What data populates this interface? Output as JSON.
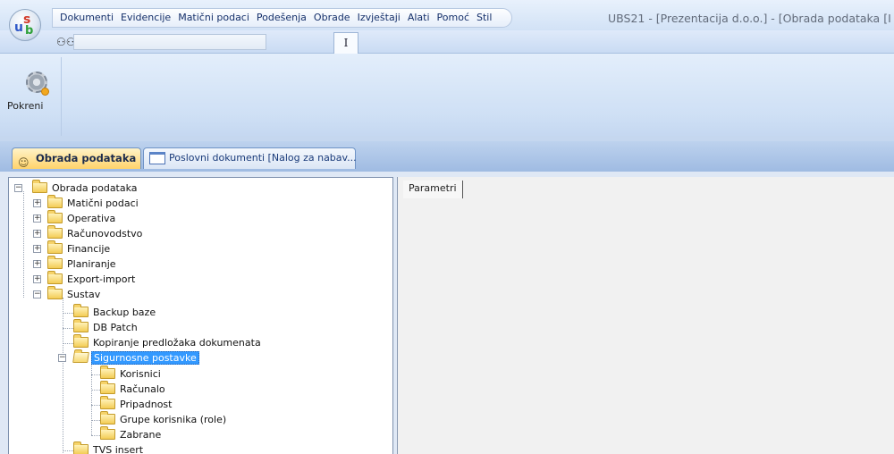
{
  "app": {
    "title": "UBS21 - [Prezentacija d.o.o.] - [Obrada podataka [I",
    "logo_text": [
      "u",
      "s",
      "b"
    ]
  },
  "menu": [
    "Dokumenti",
    "Evidencije",
    "Matični podaci",
    "Podešenja",
    "Obrade",
    "Izvještaji",
    "Alati",
    "Pomoć",
    "Stil"
  ],
  "quickbar": {
    "search_value": "",
    "tab_label": "I"
  },
  "ribbon": {
    "run_label": "Pokreni"
  },
  "doc_tabs": [
    {
      "label": "Obrada podataka",
      "active": true,
      "icon": "people-icon"
    },
    {
      "label": "Poslovni dokumenti [Nalog za nabav...",
      "active": false,
      "icon": "document-icon"
    }
  ],
  "tree": {
    "root": "Obrada podataka",
    "items": [
      {
        "label": "Matični podaci",
        "expander": "+"
      },
      {
        "label": "Operativa",
        "expander": "+"
      },
      {
        "label": "Računovodstvo",
        "expander": "+"
      },
      {
        "label": "Financije",
        "expander": "+"
      },
      {
        "label": "Planiranje",
        "expander": "+"
      },
      {
        "label": "Export-import",
        "expander": "+"
      },
      {
        "label": "Sustav",
        "expander": "−"
      },
      {
        "label": "Backup baze"
      },
      {
        "label": "DB Patch"
      },
      {
        "label": "Kopiranje predložaka dokumenata"
      },
      {
        "label": "Sigurnosne postavke",
        "expander": "−",
        "selected": true
      },
      {
        "label": "Korisnici"
      },
      {
        "label": "Računalo"
      },
      {
        "label": "Pripadnost"
      },
      {
        "label": "Grupe korisnika (role)"
      },
      {
        "label": "Zabrane"
      },
      {
        "label": "TVS insert"
      }
    ]
  },
  "right_panel": {
    "tab_label": "Parametri"
  },
  "colors": {
    "selection": "#3399ff",
    "active_tab": "#ffd36b",
    "ribbon": "#cfe0f5"
  }
}
